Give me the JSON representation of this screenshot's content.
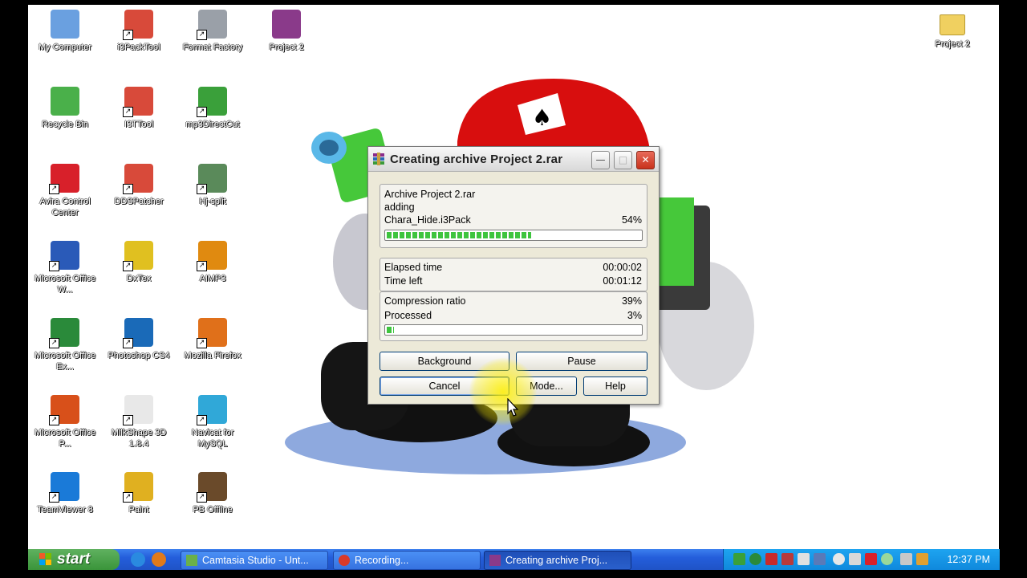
{
  "desktop": {
    "icons": [
      {
        "label": "My Computer",
        "icon": "my-computer-icon",
        "color": "#6aa0e0"
      },
      {
        "label": "i3PackTool",
        "icon": "i3packtool-icon",
        "color": "#d84a3a"
      },
      {
        "label": "Format Factory",
        "icon": "format-factory-icon",
        "color": "#9aa0a8"
      },
      {
        "label": "Project 2",
        "icon": "winrar-archive-icon",
        "color": "#8a3a8a"
      },
      {
        "label": "Recycle Bin",
        "icon": "recycle-bin-icon",
        "color": "#4ab04a"
      },
      {
        "label": "I3TTool",
        "icon": "i3ttool-icon",
        "color": "#d84a3a"
      },
      {
        "label": "mp3DirectCut",
        "icon": "mp3directcut-icon",
        "color": "#3aa03a"
      },
      {
        "label": "Avira Control Center",
        "icon": "avira-icon",
        "color": "#d8202a"
      },
      {
        "label": "DDSPatcher",
        "icon": "ddspatcher-icon",
        "color": "#d84a3a"
      },
      {
        "label": "Hj-split",
        "icon": "hj-split-icon",
        "color": "#5a8a5a"
      },
      {
        "label": "Microsoft Office W...",
        "icon": "word-icon",
        "color": "#2a5ab8"
      },
      {
        "label": "DxTex",
        "icon": "dxtex-icon",
        "color": "#e0c020"
      },
      {
        "label": "AIMP3",
        "icon": "aimp3-icon",
        "color": "#e08a10"
      },
      {
        "label": "Microsoft Office Ex...",
        "icon": "excel-icon",
        "color": "#2a8a3a"
      },
      {
        "label": "Photoshop CS4",
        "icon": "photoshop-icon",
        "color": "#1a6ab8"
      },
      {
        "label": "Mozilla Firefox",
        "icon": "firefox-icon",
        "color": "#e0701a"
      },
      {
        "label": "Microsoft Office P...",
        "icon": "powerpoint-icon",
        "color": "#d8501a"
      },
      {
        "label": "MilkShape 3D 1.8.4",
        "icon": "milkshape-icon",
        "color": "#e8e8e8"
      },
      {
        "label": "Navicat for MySQL",
        "icon": "navicat-icon",
        "color": "#30a8d8"
      },
      {
        "label": "TeamViewer 8",
        "icon": "teamviewer-icon",
        "color": "#1a7ad8"
      },
      {
        "label": "Paint",
        "icon": "paint-icon",
        "color": "#e0b020"
      },
      {
        "label": "PB Offline",
        "icon": "pb-offline-icon",
        "color": "#6a4a2a"
      }
    ],
    "right_icon": {
      "label": "Project 2",
      "icon": "folder-icon",
      "color": "#f0d060"
    }
  },
  "dialog": {
    "title": "Creating archive Project 2.rar",
    "archive_line": "Archive Project 2.rar",
    "action_line": "adding",
    "file_name": "Chara_Hide.i3Pack",
    "file_percent_text": "54%",
    "file_progress": 0.57,
    "elapsed_label": "Elapsed time",
    "elapsed_value": "00:00:02",
    "left_label": "Time left",
    "left_value": "00:01:12",
    "ratio_label": "Compression ratio",
    "ratio_value": "39%",
    "processed_label": "Processed",
    "processed_value": "3%",
    "total_progress": 0.03,
    "buttons": {
      "background": "Background",
      "pause": "Pause",
      "cancel": "Cancel",
      "mode": "Mode...",
      "help": "Help"
    },
    "minimize_glyph": "—",
    "maximize_glyph": "□",
    "close_glyph": "✕"
  },
  "taskbar": {
    "start_label": "start",
    "tasks": [
      {
        "label": "Camtasia Studio - Unt...",
        "icon": "camtasia-icon",
        "color": "#6ab04a"
      },
      {
        "label": "Recording...",
        "icon": "recording-icon",
        "color": "#d83a2a"
      },
      {
        "label": "Creating archive Proj...",
        "icon": "winrar-icon",
        "color": "#8a3a8a"
      }
    ],
    "clock": "12:37 PM"
  }
}
